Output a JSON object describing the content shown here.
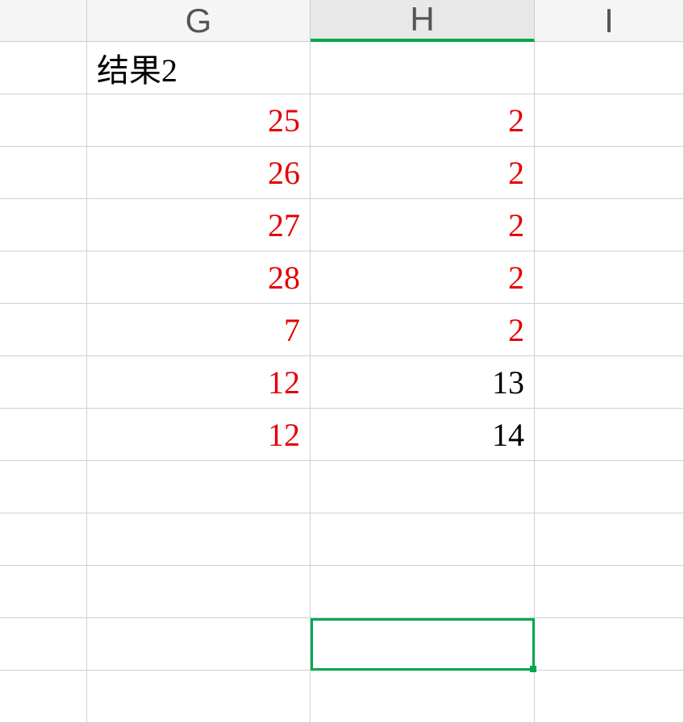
{
  "columns": {
    "g": "G",
    "h": "H",
    "i": "I"
  },
  "active_column": "H",
  "rows": [
    {
      "g": "结果2",
      "g_color": "black",
      "g_align": "left",
      "h": "",
      "h_color": "black"
    },
    {
      "g": "25",
      "g_color": "red",
      "g_align": "right",
      "h": "2",
      "h_color": "red"
    },
    {
      "g": "26",
      "g_color": "red",
      "g_align": "right",
      "h": "2",
      "h_color": "red"
    },
    {
      "g": "27",
      "g_color": "red",
      "g_align": "right",
      "h": "2",
      "h_color": "red"
    },
    {
      "g": "28",
      "g_color": "red",
      "g_align": "right",
      "h": "2",
      "h_color": "red"
    },
    {
      "g": "7",
      "g_color": "red",
      "g_align": "right",
      "h": "2",
      "h_color": "red"
    },
    {
      "g": "12",
      "g_color": "red",
      "g_align": "right",
      "h": "13",
      "h_color": "black"
    },
    {
      "g": "12",
      "g_color": "red",
      "g_align": "right",
      "h": "14",
      "h_color": "black"
    },
    {
      "g": "",
      "g_color": "black",
      "g_align": "right",
      "h": "",
      "h_color": "black"
    },
    {
      "g": "",
      "g_color": "black",
      "g_align": "right",
      "h": "",
      "h_color": "black"
    },
    {
      "g": "",
      "g_color": "black",
      "g_align": "right",
      "h": "",
      "h_color": "black"
    },
    {
      "g": "",
      "g_color": "black",
      "g_align": "right",
      "h": "",
      "h_color": "black",
      "selected": true
    },
    {
      "g": "",
      "g_color": "black",
      "g_align": "right",
      "h": "",
      "h_color": "black"
    }
  ]
}
